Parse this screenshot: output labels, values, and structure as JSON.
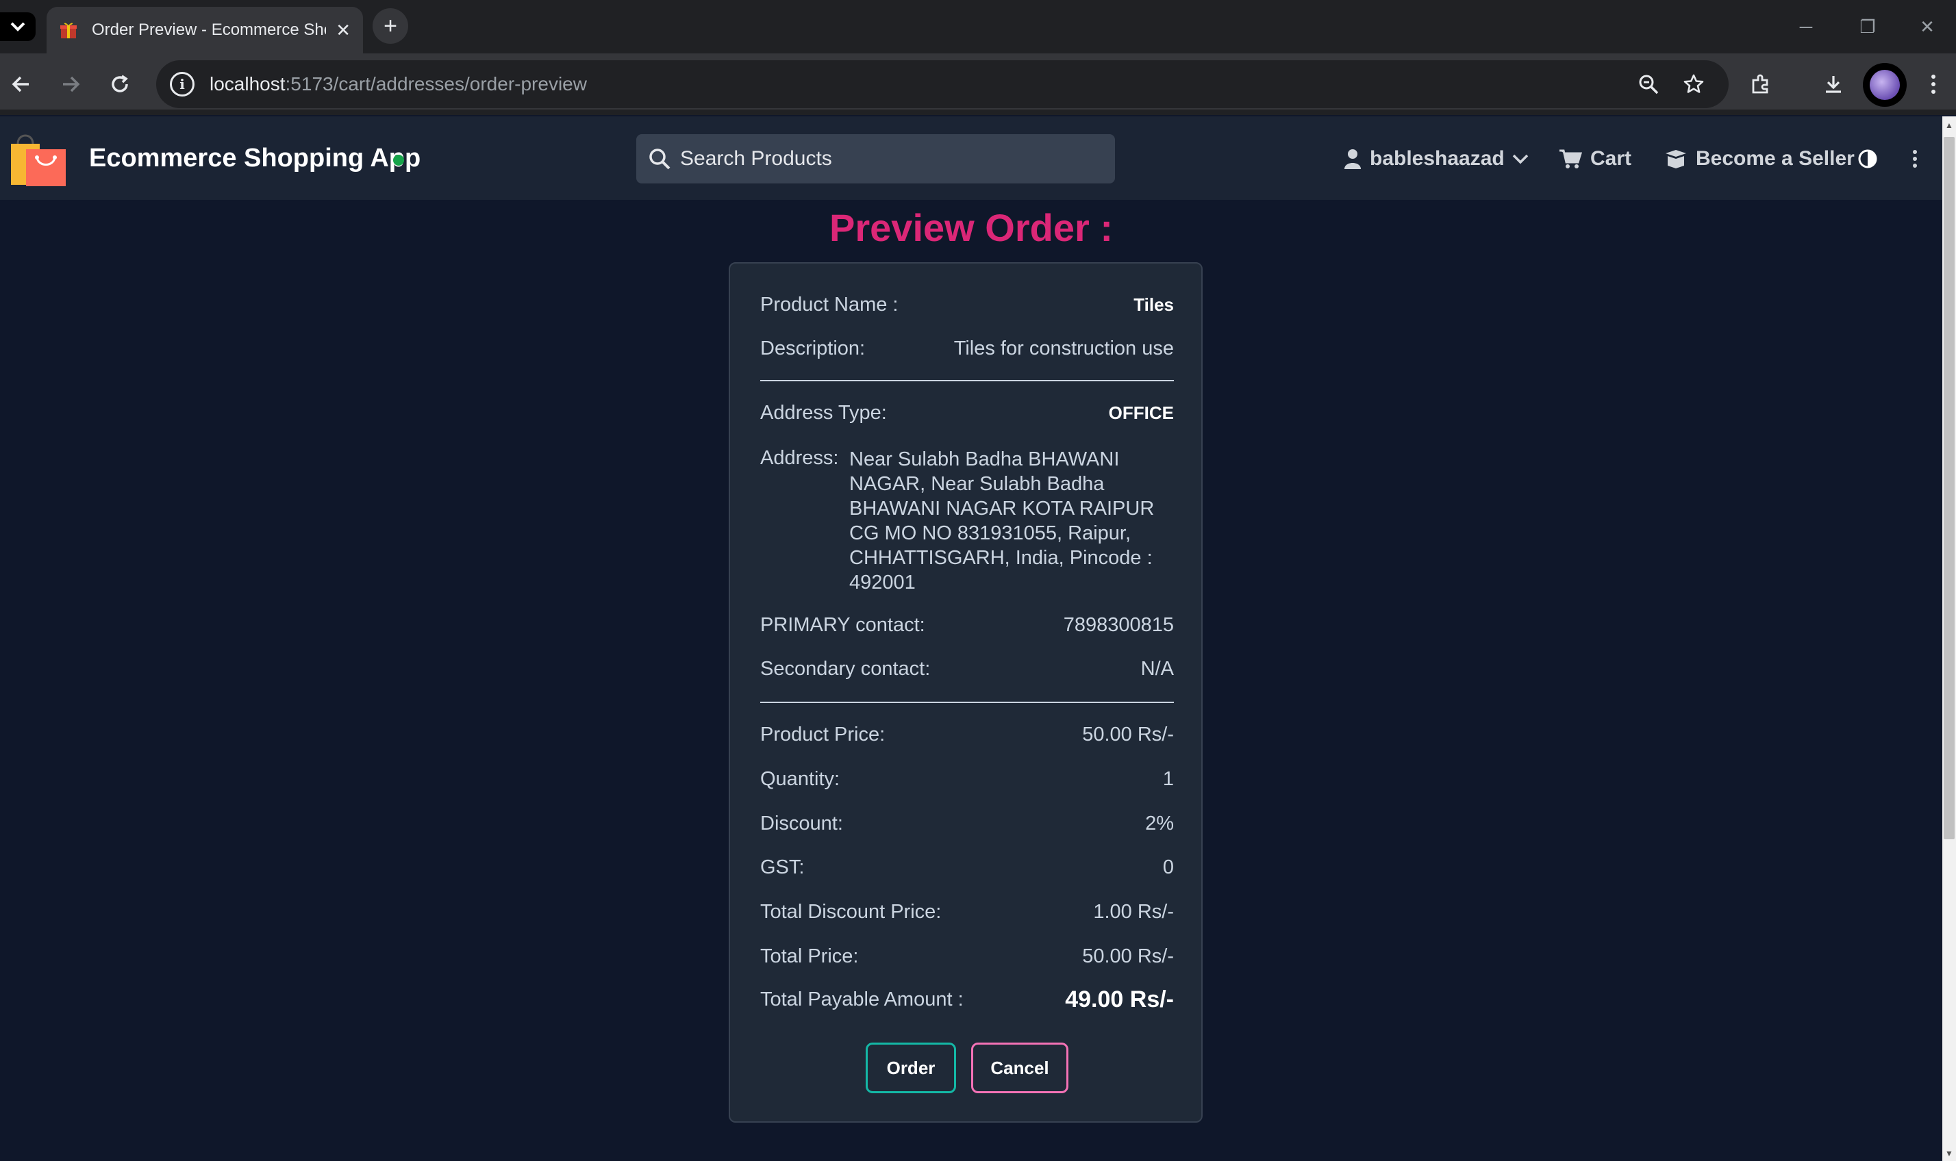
{
  "browser": {
    "tab_title": "Order Preview - Ecommerce Shopping App",
    "url_host": "localhost",
    "url_path": ":5173/cart/addresses/order-preview"
  },
  "header": {
    "brand": "Ecommerce Shopping App",
    "search_placeholder": "Search Products",
    "username": "bableshaazad",
    "cart_label": "Cart",
    "seller_label": "Become a Seller"
  },
  "page": {
    "title": "Preview Order :"
  },
  "order": {
    "product_name_label": "Product Name :",
    "product_name": "Tiles",
    "description_label": "Description:",
    "description": "Tiles for construction use",
    "address_type_label": "Address Type:",
    "address_type": "OFFICE",
    "address_label": "Address:",
    "address": "Near Sulabh Badha BHAWANI NAGAR, Near Sulabh Badha BHAWANI NAGAR KOTA RAIPUR CG MO NO 831931055, Raipur, CHHATTISGARH, India, Pincode : 492001",
    "primary_contact_label": "PRIMARY contact:",
    "primary_contact": "7898300815",
    "secondary_contact_label": "Secondary contact:",
    "secondary_contact": "N/A",
    "product_price_label": "Product Price:",
    "product_price": "50.00 Rs/-",
    "quantity_label": "Quantity:",
    "quantity": "1",
    "discount_label": "Discount:",
    "discount": "2%",
    "gst_label": "GST:",
    "gst": "0",
    "total_discount_label": "Total Discount Price:",
    "total_discount": "1.00 Rs/-",
    "total_price_label": "Total Price:",
    "total_price": "50.00 Rs/-",
    "total_payable_label": "Total Payable Amount :",
    "total_payable": "49.00 Rs/-"
  },
  "actions": {
    "order_label": "Order",
    "cancel_label": "Cancel"
  },
  "colors": {
    "accent_pink": "#db2777",
    "order_border": "#14b8a6",
    "cancel_border": "#f472b6"
  }
}
